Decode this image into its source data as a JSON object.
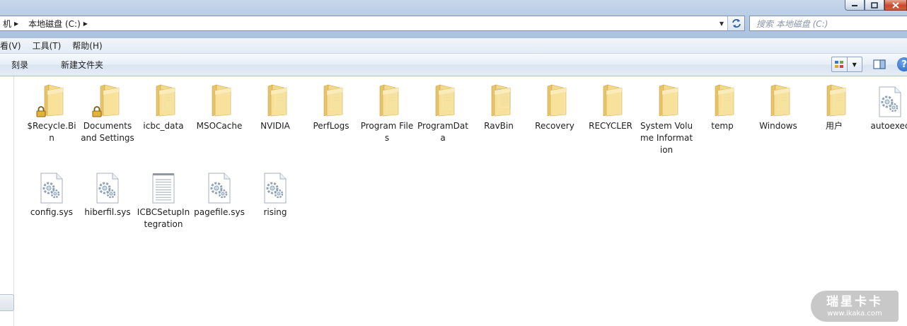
{
  "address": {
    "crumbs": [
      "机",
      "本地磁盘 (C:)"
    ],
    "search_placeholder": "搜索 本地磁盘 (C:)"
  },
  "menu": [
    "看(V)",
    "工具(T)",
    "帮助(H)"
  ],
  "commands": [
    "刻录",
    "新建文件夹"
  ],
  "items": [
    {
      "label": "$Recycle.Bin",
      "kind": "folder-empty",
      "locked": true
    },
    {
      "label": "Documents and Settings",
      "kind": "folder-empty",
      "locked": true
    },
    {
      "label": "icbc_data",
      "kind": "folder-docs",
      "locked": false
    },
    {
      "label": "MSOCache",
      "kind": "folder-empty",
      "locked": false
    },
    {
      "label": "NVIDIA",
      "kind": "folder-docs",
      "locked": false
    },
    {
      "label": "PerfLogs",
      "kind": "folder-docs",
      "locked": false
    },
    {
      "label": "Program Files",
      "kind": "folder-docs",
      "locked": false
    },
    {
      "label": "ProgramData",
      "kind": "folder-docs",
      "locked": false
    },
    {
      "label": "RavBin",
      "kind": "folder-full",
      "locked": false
    },
    {
      "label": "Recovery",
      "kind": "folder-empty",
      "locked": false
    },
    {
      "label": "RECYCLER",
      "kind": "folder-empty",
      "locked": false
    },
    {
      "label": "System Volume Information",
      "kind": "folder-empty",
      "locked": false
    },
    {
      "label": "temp",
      "kind": "folder-docs",
      "locked": false
    },
    {
      "label": "Windows",
      "kind": "folder-docs",
      "locked": false
    },
    {
      "label": "用户",
      "kind": "folder-docs",
      "locked": false
    },
    {
      "label": "autoexec",
      "kind": "sys-file",
      "locked": false
    },
    {
      "label": "config.sys",
      "kind": "sys-file",
      "locked": false
    },
    {
      "label": "hiberfil.sys",
      "kind": "sys-file",
      "locked": false
    },
    {
      "label": "ICBCSetupIntegration",
      "kind": "text-file",
      "locked": false
    },
    {
      "label": "pagefile.sys",
      "kind": "sys-file",
      "locked": false
    },
    {
      "label": "rising",
      "kind": "sys-file",
      "locked": false
    }
  ],
  "watermark": {
    "brand": "瑞星卡卡",
    "url": "www.ikaka.com"
  }
}
